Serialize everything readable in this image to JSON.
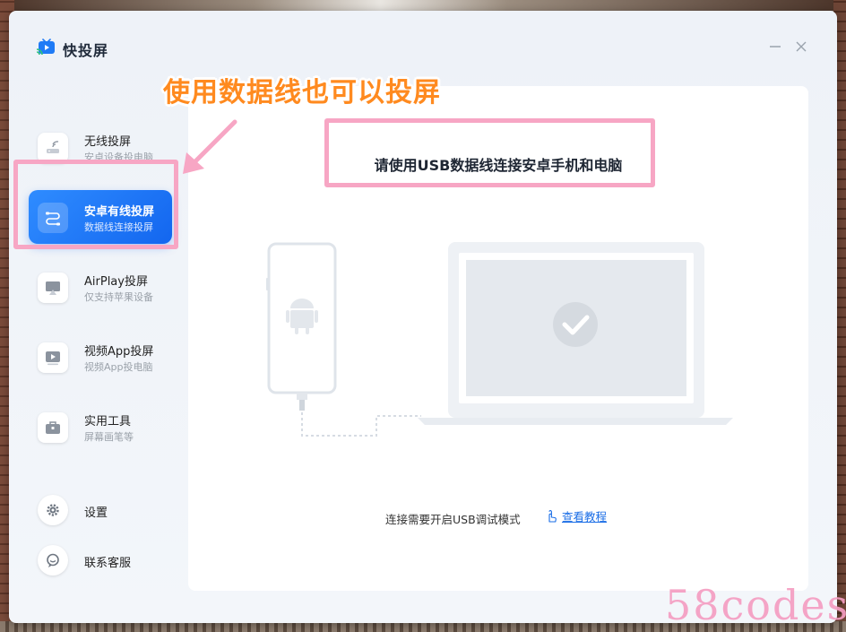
{
  "app": {
    "title": "快投屏",
    "window_controls": {
      "minimize_icon": "minimize-icon",
      "close_icon": "close-icon"
    }
  },
  "sidebar": {
    "items": [
      {
        "label": "无线投屏",
        "sublabel": "安卓设备投电脑",
        "icon": "wireless-router-icon",
        "active": false
      },
      {
        "label": "安卓有线投屏",
        "sublabel": "数据线连接投屏",
        "icon": "usb-cable-icon",
        "active": true
      },
      {
        "label": "AirPlay投屏",
        "sublabel": "仅支持苹果设备",
        "icon": "airplay-icon",
        "active": false
      },
      {
        "label": "视频App投屏",
        "sublabel": "视频App投电脑",
        "icon": "video-play-icon",
        "active": false
      },
      {
        "label": "实用工具",
        "sublabel": "屏幕画笔等",
        "icon": "toolbox-icon",
        "active": false
      }
    ],
    "bottom": [
      {
        "label": "设置",
        "icon": "gear-icon"
      },
      {
        "label": "联系客服",
        "icon": "chat-icon"
      }
    ]
  },
  "main": {
    "instruction": "请使用USB数据线连接安卓手机和电脑",
    "usb_note": "连接需要开启USB调试模式",
    "tutorial_link": "查看教程"
  },
  "annotation": {
    "caption": "使用数据线也可以投屏",
    "color_caption": "#ff8a1f",
    "color_box": "#f7a6c4"
  },
  "watermark": "58codes",
  "colors": {
    "accent": "#1a6de6",
    "active_nav": "#1f78f5"
  }
}
